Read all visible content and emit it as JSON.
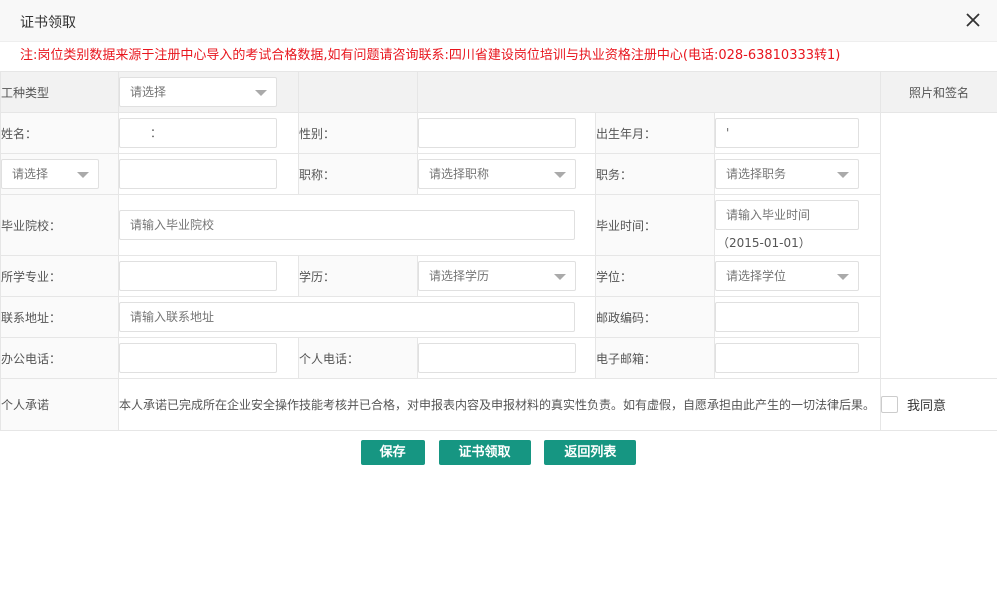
{
  "dialog": {
    "title": "证书领取",
    "notice": "注:岗位类别数据来源于注册中心导入的考试合格数据,如有问题请咨询联系:四川省建设岗位培训与执业资格注册中心(电话:028-63810333转1)"
  },
  "form": {
    "work_type": {
      "label": "工种类型",
      "value": "请选择"
    },
    "photo_header": "照片和签名",
    "name": {
      "label": "姓名：",
      "value": "："
    },
    "gender": {
      "label": "性别：",
      "value": ""
    },
    "birth": {
      "label": "出生年月：",
      "value": "'"
    },
    "id_type": {
      "value": "请选择"
    },
    "id_number": {
      "value": ""
    },
    "title_rank": {
      "label": "职称：",
      "value": "请选择职称"
    },
    "position": {
      "label": "职务：",
      "value": "请选择职务"
    },
    "school": {
      "label": "毕业院校：",
      "placeholder": "请输入毕业院校"
    },
    "grad_time": {
      "label": "毕业时间：",
      "placeholder": "请输入毕业时间",
      "hint": "（2015-01-01）"
    },
    "major": {
      "label": "所学专业：",
      "value": ""
    },
    "education": {
      "label": "学历：",
      "value": "请选择学历"
    },
    "degree": {
      "label": "学位：",
      "value": "请选择学位"
    },
    "address": {
      "label": "联系地址：",
      "placeholder": "请输入联系地址"
    },
    "postcode": {
      "label": "邮政编码：",
      "value": ""
    },
    "office_phone": {
      "label": "办公电话：",
      "value": ""
    },
    "mobile": {
      "label": "个人电话：",
      "value": ""
    },
    "email": {
      "label": "电子邮箱：",
      "value": ""
    },
    "promise": {
      "label": "个人承诺",
      "text": "本人承诺已完成所在企业安全操作技能考核并已合格，对申报表内容及申报材料的真实性负责。如有虚假，自愿承担由此产生的一切法律后果。",
      "agree_label": "我同意"
    }
  },
  "buttons": {
    "save": "保存",
    "receive": "证书领取",
    "back": "返回列表"
  },
  "colors": {
    "accent": "#169682",
    "notice": "#e8161e"
  }
}
